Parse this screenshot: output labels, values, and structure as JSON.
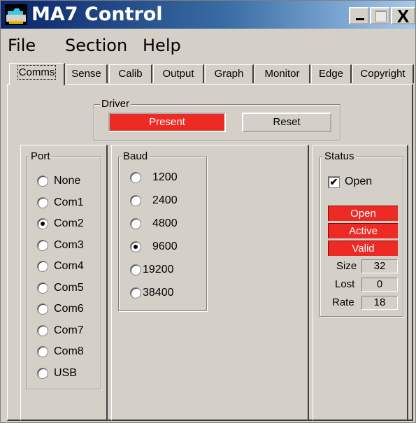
{
  "window": {
    "title": "MA7 Control"
  },
  "title_buttons": {
    "minimize": "_",
    "maximize": "□",
    "close": "X"
  },
  "menu": [
    "File",
    "Section",
    "Help"
  ],
  "tabs": [
    "Comms",
    "Sense",
    "Calib",
    "Output",
    "Graph",
    "Monitor",
    "Edge",
    "Copyright"
  ],
  "driver": {
    "legend": "Driver",
    "present_label": "Present",
    "reset_label": "Reset"
  },
  "port": {
    "legend": "Port",
    "options": [
      "None",
      "Com1",
      "Com2",
      "Com3",
      "Com4",
      "Com5",
      "Com6",
      "Com7",
      "Com8",
      "USB"
    ],
    "selected": "Com2"
  },
  "baud": {
    "legend": "Baud",
    "options": [
      "1200",
      "2400",
      "4800",
      "9600",
      "19200",
      "38400"
    ],
    "selected": "9600"
  },
  "status": {
    "legend": "Status",
    "open_checkbox_label": "Open",
    "open_checked": true,
    "indicators": [
      "Open",
      "Active",
      "Valid"
    ],
    "size_label": "Size",
    "size_value": "32",
    "lost_label": "Lost",
    "lost_value": "0",
    "rate_label": "Rate",
    "rate_value": "18"
  },
  "colors": {
    "indicator_red": "#ee2a25",
    "face": "#d4d0c8",
    "titlebar": "#0a246a"
  },
  "icons": {
    "app": "app-icon",
    "checkmark": "check-icon"
  }
}
